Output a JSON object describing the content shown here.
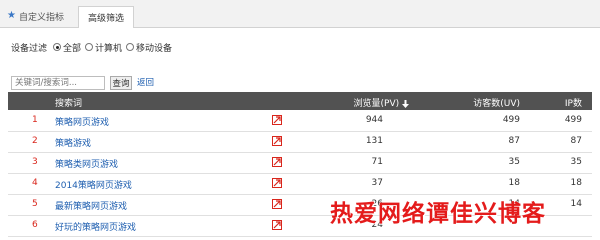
{
  "tabs": {
    "custom_label": "自定义指标",
    "advanced_label": "高级筛选"
  },
  "filter": {
    "label": "设备过滤",
    "options": [
      "全部",
      "计算机",
      "移动设备"
    ],
    "selected": "全部"
  },
  "search": {
    "placeholder": "关键词/搜索词...",
    "button_label": "查询",
    "back_label": "返回"
  },
  "table": {
    "headers": {
      "keyword": "搜索词",
      "pv": "浏览量(PV)",
      "uv": "访客数(UV)",
      "ip": "IP数"
    },
    "sort_icon": "arrow-down-icon",
    "rows": [
      {
        "index": "1",
        "keyword": "策略网页游戏",
        "pv": "944",
        "uv": "499",
        "ip": "499"
      },
      {
        "index": "2",
        "keyword": "策略游戏",
        "pv": "131",
        "uv": "87",
        "ip": "87"
      },
      {
        "index": "3",
        "keyword": "策略类网页游戏",
        "pv": "71",
        "uv": "35",
        "ip": "35"
      },
      {
        "index": "4",
        "keyword": "2014策略网页游戏",
        "pv": "37",
        "uv": "18",
        "ip": "18"
      },
      {
        "index": "5",
        "keyword": "最新策略网页游戏",
        "pv": "26",
        "uv": "14",
        "ip": "14"
      },
      {
        "index": "6",
        "keyword": "好玩的策略网页游戏",
        "pv": "24",
        "uv": "",
        "ip": ""
      }
    ]
  },
  "watermark": "热爱网络谭佳兴博客",
  "colors": {
    "accent_red": "#d9261c",
    "link_blue": "#1f5fb0",
    "header_bg": "#525252"
  }
}
